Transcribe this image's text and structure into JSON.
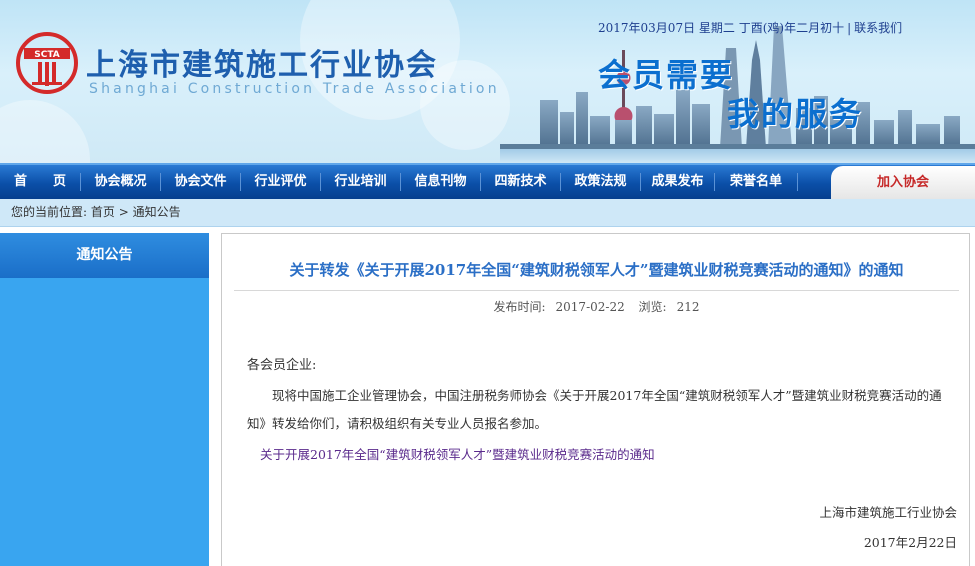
{
  "header": {
    "logo_text": "SCTA",
    "title": "上海市建筑施工行业协会",
    "subtitle": "Shanghai Construction Trade Association",
    "date": "2017年03月07日 星期二 丁酉(鸡)年二月初十",
    "contact_link": "联系我们",
    "slogan_line1": "会员需要",
    "slogan_line2": "我的服务"
  },
  "nav": {
    "items": [
      {
        "label": "首　　页"
      },
      {
        "label": "协会概况"
      },
      {
        "label": "协会文件"
      },
      {
        "label": "行业评优"
      },
      {
        "label": "行业培训"
      },
      {
        "label": "信息刊物"
      },
      {
        "label": "四新技术"
      },
      {
        "label": "政策法规"
      },
      {
        "label": "成果发布"
      },
      {
        "label": "荣誉名单"
      }
    ],
    "join_label": "加入协会"
  },
  "breadcrumb": {
    "prefix": "您的当前位置:",
    "home": "首页",
    "arrow": ">",
    "current": "通知公告"
  },
  "sidebar": {
    "title": "通知公告"
  },
  "article": {
    "title": "关于转发《关于开展2017年全国“建筑财税领军人才”暨建筑业财税竞赛活动的通知》的通知",
    "published_label": "发布时间:",
    "published_value": "2017-02-22",
    "views_label": "浏览:",
    "views_value": "212",
    "greeting": "各会员企业:",
    "body": "现将中国施工企业管理协会，中国注册税务师协会《关于开展2017年全国“建筑财税领军人才”暨建筑业财税竞赛活动的通知》转发给你们，请积极组织有关专业人员报名参加。",
    "attachment_link": "关于开展2017年全国“建筑财税领军人才”暨建筑业财税竞赛活动的通知",
    "signature": "上海市建筑施工行业协会",
    "sign_date": "2017年2月22日"
  },
  "colors": {
    "nav_blue": "#0b4fa8",
    "title_blue": "#2b6fc6",
    "sidebar_blue": "#39a5f0",
    "logo_red": "#d42a2a",
    "link_purple": "#5a2a8c"
  }
}
